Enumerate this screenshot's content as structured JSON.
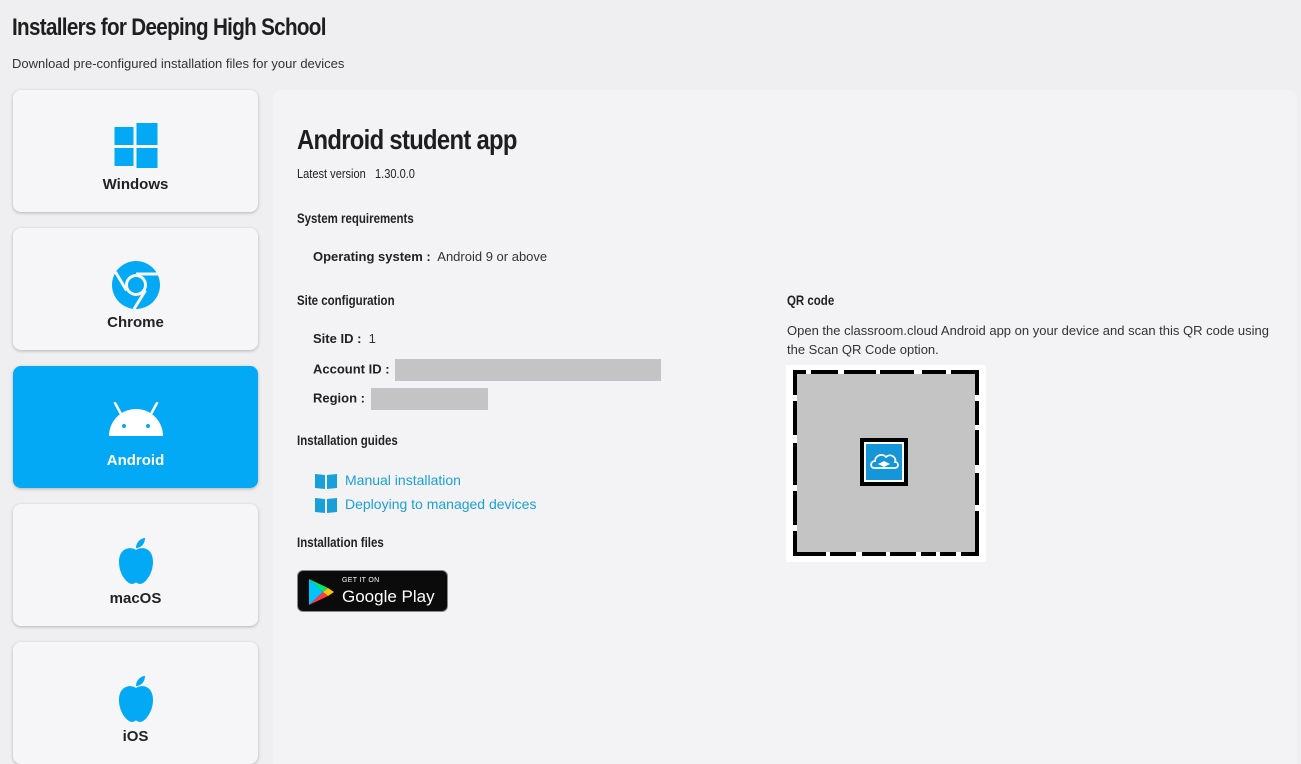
{
  "header": {
    "title": "Installers for Deeping High School",
    "subtitle": "Download pre-configured installation files for your devices"
  },
  "sidebar": {
    "items": [
      {
        "label": "Windows",
        "icon": "windows-icon",
        "active": false
      },
      {
        "label": "Chrome",
        "icon": "chrome-icon",
        "active": false
      },
      {
        "label": "Android",
        "icon": "android-icon",
        "active": true
      },
      {
        "label": "macOS",
        "icon": "apple-icon",
        "active": false
      },
      {
        "label": "iOS",
        "icon": "apple-icon",
        "active": false
      }
    ]
  },
  "main": {
    "app_title": "Android student app",
    "latest_version_label": "Latest version",
    "latest_version": "1.30.0.0",
    "system_requirements": {
      "heading": "System requirements",
      "os_label": "Operating system :",
      "os_value": "Android 9 or above"
    },
    "site_configuration": {
      "heading": "Site configuration",
      "site_id_label": "Site ID :",
      "site_id_value": "1",
      "account_id_label": "Account ID :",
      "region_label": "Region :"
    },
    "installation_guides": {
      "heading": "Installation guides",
      "links": [
        "Manual installation",
        "Deploying to managed devices"
      ]
    },
    "installation_files": {
      "heading": "Installation files",
      "badge_small": "GET IT ON",
      "badge_big": "Google Play"
    },
    "qr": {
      "heading": "QR code",
      "description": "Open the classroom.cloud Android app on your device and scan this QR code using the Scan QR Code option."
    }
  },
  "colors": {
    "accent": "#03a9f4",
    "link": "#1a9fd8",
    "background": "#efeff1",
    "panel": "#f3f3f6"
  }
}
